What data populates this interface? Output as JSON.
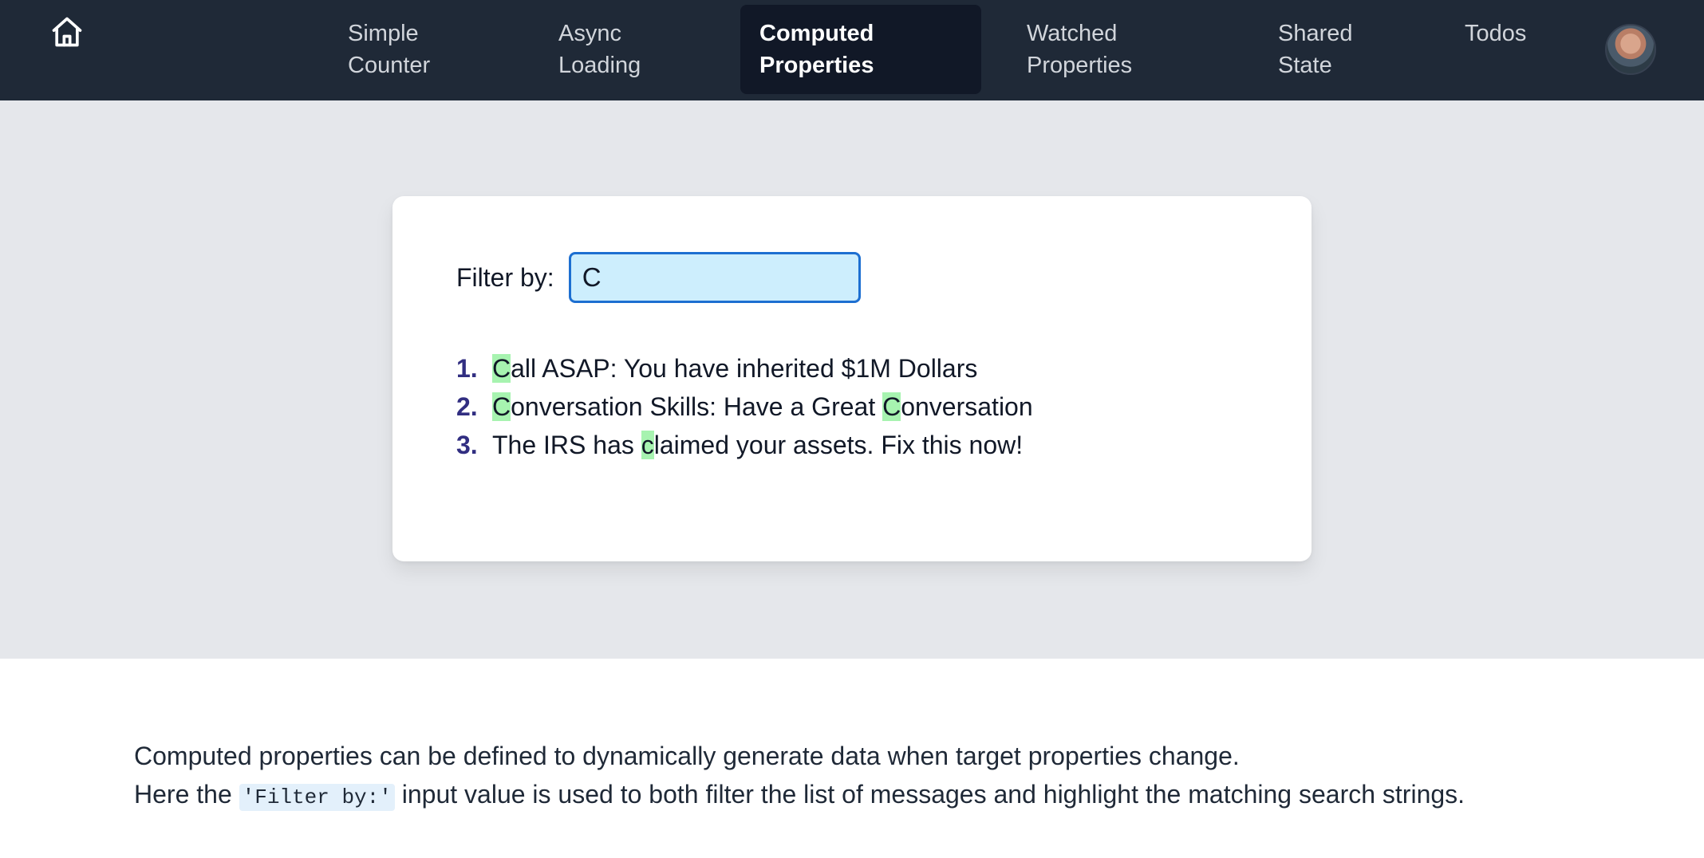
{
  "nav": {
    "home_icon": "home-icon",
    "items": [
      {
        "line1": "Simple",
        "line2": "Counter"
      },
      {
        "line1": "Async",
        "line2": "Loading"
      },
      {
        "line1": "Computed",
        "line2": "Properties",
        "active": true
      },
      {
        "line1": "Watched",
        "line2": "Properties"
      },
      {
        "line1": "Shared",
        "line2": "State"
      },
      {
        "line1": "Todos",
        "line2": ""
      }
    ],
    "avatar": "user-avatar"
  },
  "filter": {
    "label": "Filter by:",
    "value": "C"
  },
  "messages": [
    {
      "number": "1.",
      "text": "Call ASAP: You have inherited $1M Dollars"
    },
    {
      "number": "2.",
      "text": "Conversation Skills: Have a Great Conversation"
    },
    {
      "number": "3.",
      "text": "The IRS has claimed your assets. Fix this now!"
    }
  ],
  "description": {
    "line1": "Computed properties can be defined to dynamically generate data when target properties change.",
    "line2_before": "Here the ",
    "line2_code": "'Filter by:'",
    "line2_after": " input value is used to both filter the list of messages and highlight the matching search strings."
  },
  "colors": {
    "nav_bg": "#1f2937",
    "highlight": "#a7f3b0",
    "input_bg": "#cdeefd",
    "input_border": "#1d6fd1"
  }
}
